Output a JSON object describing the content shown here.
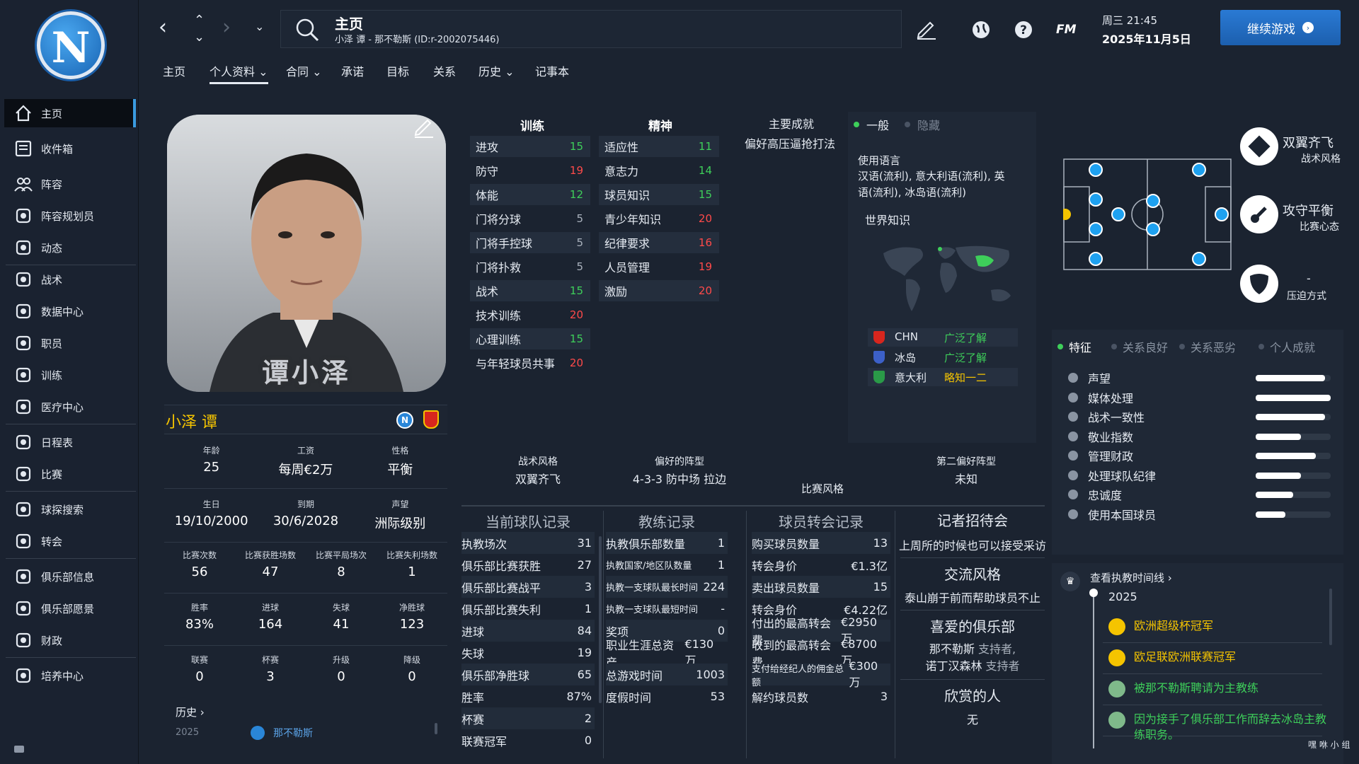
{
  "nav": {
    "items": [
      {
        "label": "主页",
        "icon": "home-icon"
      },
      {
        "label": "收件箱",
        "icon": "inbox-icon"
      },
      {
        "label": "阵容",
        "icon": "squad-icon"
      },
      {
        "label": "阵容规划员",
        "icon": "squad-planner-icon"
      },
      {
        "label": "动态",
        "icon": "dynamics-icon"
      },
      {
        "label": "战术",
        "icon": "tactics-icon"
      },
      {
        "label": "数据中心",
        "icon": "data-hub-icon"
      },
      {
        "label": "职员",
        "icon": "staff-icon"
      },
      {
        "label": "训练",
        "icon": "training-icon"
      },
      {
        "label": "医疗中心",
        "icon": "medical-icon"
      },
      {
        "label": "日程表",
        "icon": "schedule-icon"
      },
      {
        "label": "比赛",
        "icon": "match-icon"
      },
      {
        "label": "球探搜索",
        "icon": "scouting-icon"
      },
      {
        "label": "转会",
        "icon": "transfer-icon"
      },
      {
        "label": "俱乐部信息",
        "icon": "club-info-icon"
      },
      {
        "label": "俱乐部愿景",
        "icon": "club-vision-icon"
      },
      {
        "label": "财政",
        "icon": "finance-icon"
      },
      {
        "label": "培养中心",
        "icon": "development-icon"
      }
    ]
  },
  "header": {
    "title": "主页",
    "subtitle": "小泽 谭 - 那不勒斯 (ID:r-2002075446)",
    "fm_label": "FM",
    "day_time": "周三 21:45",
    "date": "2025年11月5日",
    "continue_label": "继续游戏"
  },
  "tabs": [
    {
      "label": "主页"
    },
    {
      "label": "个人资料 ⌄"
    },
    {
      "label": "合同 ⌄"
    },
    {
      "label": "承诺"
    },
    {
      "label": "目标"
    },
    {
      "label": "关系"
    },
    {
      "label": "历史 ⌄"
    },
    {
      "label": "记事本"
    }
  ],
  "profile": {
    "photo_caption": "谭小泽",
    "name": "小泽 谭",
    "stats": [
      [
        {
          "label": "年龄",
          "value": "25"
        },
        {
          "label": "工资",
          "value": "每周€2万"
        },
        {
          "label": "性格",
          "value": "平衡"
        }
      ],
      [
        {
          "label": "生日",
          "value": "19/10/2000"
        },
        {
          "label": "到期",
          "value": "30/6/2028"
        },
        {
          "label": "声望",
          "value": "洲际级别"
        }
      ],
      [
        {
          "label": "比赛次数",
          "value": "56"
        },
        {
          "label": "比赛获胜场数",
          "value": "47"
        },
        {
          "label": "比赛平局场次",
          "value": "8"
        },
        {
          "label": "比赛失利场数",
          "value": "1"
        }
      ],
      [
        {
          "label": "胜率",
          "value": "83%"
        },
        {
          "label": "进球",
          "value": "164"
        },
        {
          "label": "失球",
          "value": "41"
        },
        {
          "label": "净胜球",
          "value": "123"
        }
      ],
      [
        {
          "label": "联赛",
          "value": "0"
        },
        {
          "label": "杯赛",
          "value": "3"
        },
        {
          "label": "升级",
          "value": "0"
        },
        {
          "label": "降级",
          "value": "0"
        }
      ]
    ],
    "history_label": "历史",
    "history_year": "2025",
    "history_club": "那不勒斯"
  },
  "attributes": {
    "training_title": "训练",
    "mental_title": "精神",
    "training": [
      {
        "name": "进攻",
        "value": "15"
      },
      {
        "name": "防守",
        "value": "19"
      },
      {
        "name": "体能",
        "value": "12"
      },
      {
        "name": "门将分球",
        "value": "5"
      },
      {
        "name": "门将手控球",
        "value": "5"
      },
      {
        "name": "门将扑救",
        "value": "5"
      },
      {
        "name": "战术",
        "value": "15"
      },
      {
        "name": "技术训练",
        "value": "20"
      },
      {
        "name": "心理训练",
        "value": "15"
      },
      {
        "name": "与年轻球员共事",
        "value": "20"
      }
    ],
    "mental": [
      {
        "name": "适应性",
        "value": "11"
      },
      {
        "name": "意志力",
        "value": "14"
      },
      {
        "name": "球员知识",
        "value": "15"
      },
      {
        "name": "青少年知识",
        "value": "20"
      },
      {
        "name": "纪律要求",
        "value": "16"
      },
      {
        "name": "人员管理",
        "value": "19"
      },
      {
        "name": "激励",
        "value": "20"
      }
    ],
    "colors": {
      "green": "#3ecf5a",
      "red": "#ff4a4a",
      "grey": "#aab2bd"
    }
  },
  "achievements": {
    "title": "主要成就",
    "text": "偏好高压逼抢打法"
  },
  "knowledge": {
    "tab_general": "一般",
    "tab_hidden": "隐藏",
    "languages_label": "使用语言",
    "languages_text": "汉语(流利), 意大利语(流利), 英语(流利), 冰岛语(流利)",
    "world_label": "世界知识",
    "nations": [
      {
        "code": "CHN",
        "level": "广泛了解",
        "color": "#3ecf5a"
      },
      {
        "code": "冰岛",
        "level": "广泛了解",
        "color": "#3ecf5a"
      },
      {
        "code": "意大利",
        "level": "略知一二",
        "color": "#f5c400"
      }
    ]
  },
  "style": {
    "tactical_label": "战术风格",
    "tactical_value": "双翼齐飞",
    "formation_label": "偏好的阵型",
    "formation_value": "4-3-3 防中场 拉边",
    "formation2_label": "第二偏好阵型",
    "formation2_value": "未知",
    "match_style_label": "比赛风格"
  },
  "records": {
    "current": {
      "title": "当前球队记录",
      "rows": [
        {
          "k": "执教场次",
          "v": "31"
        },
        {
          "k": "俱乐部比赛获胜",
          "v": "27"
        },
        {
          "k": "俱乐部比赛战平",
          "v": "3"
        },
        {
          "k": "俱乐部比赛失利",
          "v": "1"
        },
        {
          "k": "进球",
          "v": "84"
        },
        {
          "k": "失球",
          "v": "19"
        },
        {
          "k": "俱乐部净胜球",
          "v": "65"
        },
        {
          "k": "胜率",
          "v": "87%"
        },
        {
          "k": "杯赛",
          "v": "2"
        },
        {
          "k": "联赛冠军",
          "v": "0"
        }
      ]
    },
    "coach": {
      "title": "教练记录",
      "rows": [
        {
          "k": "执教俱乐部数量",
          "v": "1"
        },
        {
          "k": "执教国家/地区队数量",
          "v": "1"
        },
        {
          "k": "执教一支球队最长时间",
          "v": "224"
        },
        {
          "k": "执教一支球队最短时间",
          "v": "-"
        },
        {
          "k": "奖项",
          "v": "0"
        },
        {
          "k": "职业生涯总资产",
          "v": "€130万"
        },
        {
          "k": "总游戏时间",
          "v": "1003"
        },
        {
          "k": "度假时间",
          "v": "53"
        }
      ]
    },
    "transfer": {
      "title": "球员转会记录",
      "rows": [
        {
          "k": "购买球员数量",
          "v": "13"
        },
        {
          "k": "转会身价",
          "v": "€1.3亿"
        },
        {
          "k": "卖出球员数量",
          "v": "15"
        },
        {
          "k": "转会身价",
          "v": "€4.22亿"
        },
        {
          "k": "付出的最高转会费",
          "v": "€2950万"
        },
        {
          "k": "收到的最高转会费",
          "v": "€8700万"
        },
        {
          "k": "支付给经纪人的佣金总额",
          "v": "€300万"
        },
        {
          "k": "解约球员数",
          "v": "3"
        }
      ]
    },
    "press": {
      "title": "记者招待会",
      "text": "上周所的时候也可以接受采访",
      "comm_title": "交流风格",
      "comm_text": "泰山崩于前而帮助球员不止",
      "fav_title": "喜爱的俱乐部",
      "fav_club1": "那不勒斯",
      "fav_role1": "支持者,",
      "fav_club2": "诺丁汉森林",
      "fav_role2": "支持者",
      "admire_title": "欣赏的人",
      "admire_value": "无"
    }
  },
  "tactics": {
    "style1_title": "双翼齐飞",
    "style1_sub": "战术风格",
    "style2_title": "攻守平衡",
    "style2_sub": "比赛心态",
    "style3_title": "-",
    "style3_sub": "压迫方式"
  },
  "traits": {
    "tabs": [
      "特征",
      "关系良好",
      "关系恶劣",
      "个人成就"
    ],
    "rows": [
      {
        "name": "声望",
        "level": 0.92
      },
      {
        "name": "媒体处理",
        "level": 1.0
      },
      {
        "name": "战术一致性",
        "level": 0.92
      },
      {
        "name": "敬业指数",
        "level": 0.6
      },
      {
        "name": "管理财政",
        "level": 0.8
      },
      {
        "name": "处理球队纪律",
        "level": 0.6
      },
      {
        "name": "忠诚度",
        "level": 0.5
      },
      {
        "name": "使用本国球员",
        "level": 0.4
      }
    ]
  },
  "timeline": {
    "link_label": "查看执教时间线",
    "year": "2025",
    "items": [
      {
        "text": "欧洲超级杯冠军",
        "color": "#f5c400",
        "dot": "#f5c400"
      },
      {
        "text": "欧足联欧洲联赛冠军",
        "color": "#f5c400",
        "dot": "#f5c400"
      },
      {
        "text": "被那不勒斯聘请为主教练",
        "color": "#3ecf5a",
        "dot": "#7fb98a"
      },
      {
        "text": "因为接手了俱乐部工作而辞去冰岛主教练职务。",
        "color": "#3ecf5a",
        "dot": "#7fb98a"
      }
    ]
  }
}
